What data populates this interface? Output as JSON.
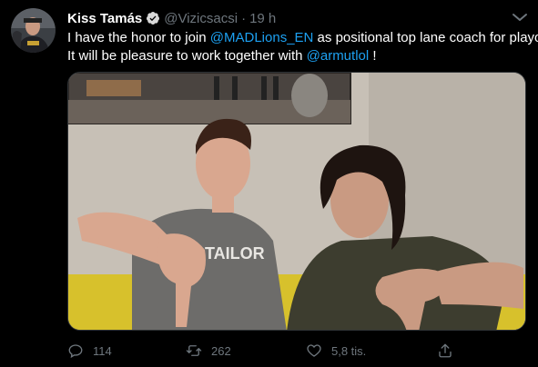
{
  "tweet": {
    "display_name": "Kiss Tamás",
    "handle": "@Vizicsacsi",
    "separator": "·",
    "time": "19 h",
    "text_line1_before": "I have the honor to join ",
    "text_line1_mention": "@MADLions_EN",
    "text_line1_after": " as positional top lane coach for playoffs!",
    "text_line2_before": "It will be pleasure to work together with ",
    "text_line2_mention": "@armutlol",
    "text_line2_after": " !"
  },
  "media": {
    "shirt_print": "TAILOR"
  },
  "actions": {
    "reply_count": "114",
    "retweet_count": "262",
    "like_count": "5,8 tis."
  },
  "icons": {
    "avatar": "avatar",
    "verified": "verified-badge-icon",
    "more": "more-options-icon",
    "reply": "reply-icon",
    "retweet": "retweet-icon",
    "like": "like-icon",
    "share": "share-icon"
  },
  "colors": {
    "background": "#000000",
    "text": "#ffffff",
    "secondary_text": "#6e767d",
    "mention": "#1da1f2"
  }
}
